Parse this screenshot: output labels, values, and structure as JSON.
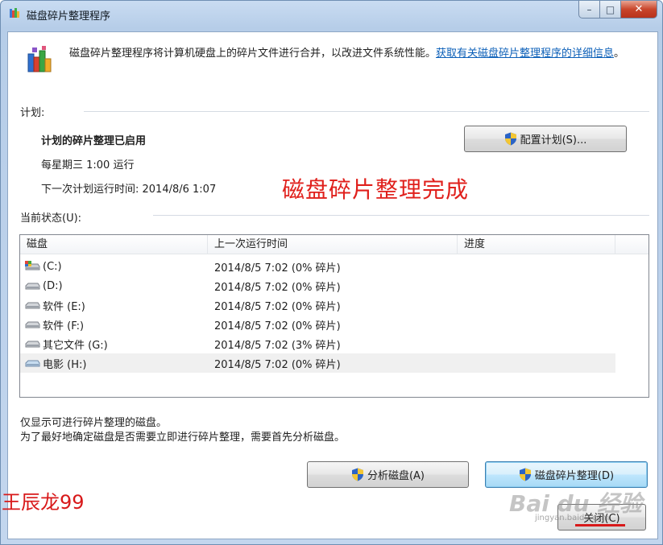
{
  "window": {
    "title": "磁盘碎片整理程序",
    "caption_min": "–",
    "caption_max": "□",
    "caption_close": "✕"
  },
  "intro": {
    "text": "磁盘碎片整理程序将计算机硬盘上的碎片文件进行合并，以改进文件系统性能。",
    "link": "获取有关磁盘碎片整理程序的详细信息",
    "link_suffix": "。"
  },
  "schedule": {
    "section_label": "计划:",
    "title": "计划的碎片整理已启用",
    "frequency": "每星期三  1:00 运行",
    "next_run": "下一次计划运行时间: 2014/8/6 1:07",
    "configure_button": "配置计划(S)..."
  },
  "overlay_text": "磁盘碎片整理完成",
  "status": {
    "section_label": "当前状态(U):",
    "columns": [
      "磁盘",
      "上一次运行时间",
      "进度"
    ],
    "rows": [
      {
        "disk": "(C:)",
        "icon": "system-drive-icon",
        "last_run": "2014/8/5 7:02 (0% 碎片)",
        "progress": ""
      },
      {
        "disk": "(D:)",
        "icon": "drive-icon",
        "last_run": "2014/8/5 7:02 (0% 碎片)",
        "progress": ""
      },
      {
        "disk": "软件 (E:)",
        "icon": "drive-icon",
        "last_run": "2014/8/5 7:02 (0% 碎片)",
        "progress": ""
      },
      {
        "disk": "软件 (F:)",
        "icon": "drive-icon",
        "last_run": "2014/8/5 7:02 (0% 碎片)",
        "progress": ""
      },
      {
        "disk": "其它文件 (G:)",
        "icon": "drive-icon",
        "last_run": "2014/8/5 7:02 (3% 碎片)",
        "progress": ""
      },
      {
        "disk": "电影 (H:)",
        "icon": "drive-icon",
        "last_run": "2014/8/5 7:02 (0% 碎片)",
        "progress": "",
        "selected": true
      }
    ]
  },
  "notes": {
    "line1": "仅显示可进行碎片整理的磁盘。",
    "line2": "为了最好地确定磁盘是否需要立即进行碎片整理，需要首先分析磁盘。"
  },
  "buttons": {
    "analyze": "分析磁盘(A)",
    "defragment": "磁盘碎片整理(D)",
    "close": "关闭(C)"
  },
  "watermarks": {
    "author": "王辰龙99",
    "baidu": "Bai du 经验",
    "url": "jingyan.baidu.com"
  }
}
